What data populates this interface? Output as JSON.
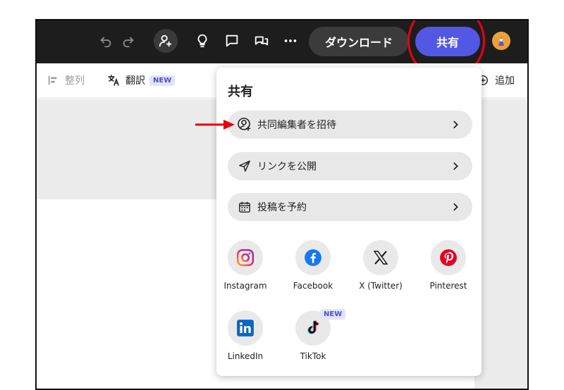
{
  "toolbar": {
    "download_label": "ダウンロード",
    "share_label": "共有"
  },
  "subbar": {
    "arrange_label": "整列",
    "translate_label": "翻訳",
    "translate_badge": "NEW",
    "add_label": "追加"
  },
  "share_panel": {
    "title": "共有",
    "options": [
      {
        "label": "共同編集者を招待",
        "icon": "person-add-icon"
      },
      {
        "label": "リンクを公開",
        "icon": "send-icon"
      },
      {
        "label": "投稿を予約",
        "icon": "calendar-icon"
      }
    ],
    "socials": [
      {
        "label": "Instagram",
        "icon": "instagram-icon"
      },
      {
        "label": "Facebook",
        "icon": "facebook-icon"
      },
      {
        "label": "X (Twitter)",
        "icon": "x-twitter-icon"
      },
      {
        "label": "Pinterest",
        "icon": "pinterest-icon"
      },
      {
        "label": "LinkedIn",
        "icon": "linkedin-icon"
      },
      {
        "label": "TikTok",
        "icon": "tiktok-icon",
        "badge": "NEW"
      }
    ]
  },
  "colors": {
    "accent": "#5258e4",
    "topbar": "#1d1d1d",
    "annotation_red": "#e60012",
    "badge_bg": "#e3e4fb",
    "badge_text": "#4a4fd0"
  }
}
